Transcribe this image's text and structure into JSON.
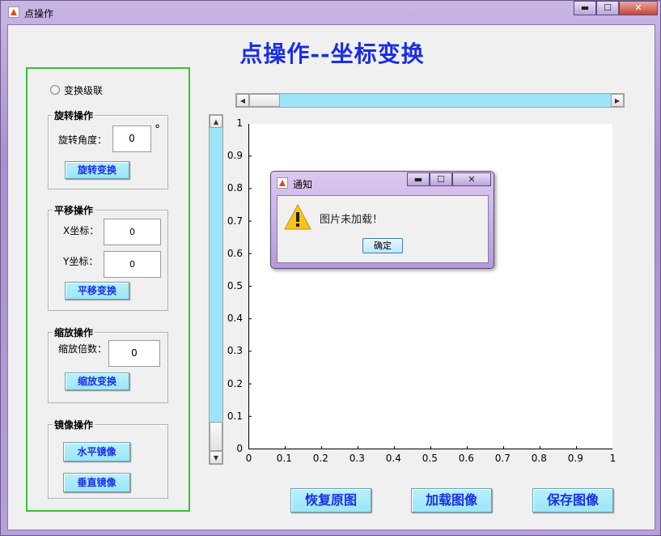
{
  "window": {
    "title": "点操作",
    "min_glyph": "▬",
    "max_glyph": "☐",
    "close_glyph": "✕"
  },
  "main_title": "点操作--坐标变换",
  "left_panel": {
    "cascade_label": "变换级联",
    "rotation": {
      "title": "旋转操作",
      "angle_label": "旋转角度：",
      "angle_value": "0",
      "degree_symbol": "°",
      "button": "旋转变换"
    },
    "translation": {
      "title": "平移操作",
      "x_label": "X坐标：",
      "x_value": "0",
      "y_label": "Y坐标：",
      "y_value": "0",
      "button": "平移变换"
    },
    "scaling": {
      "title": "缩放操作",
      "factor_label": "缩放倍数：",
      "factor_value": "0",
      "button": "缩放变换"
    },
    "mirror": {
      "title": "镜像操作",
      "horizontal_button": "水平镜像",
      "vertical_button": "垂直镜像"
    }
  },
  "axes": {
    "x_ticks": [
      "0",
      "0.1",
      "0.2",
      "0.3",
      "0.4",
      "0.5",
      "0.6",
      "0.7",
      "0.8",
      "0.9",
      "1"
    ],
    "y_ticks": [
      "0",
      "0.1",
      "0.2",
      "0.3",
      "0.4",
      "0.5",
      "0.6",
      "0.7",
      "0.8",
      "0.9",
      "1"
    ]
  },
  "scrollbars": {
    "horizontal_thumb_fraction": 0.0,
    "vertical_thumb_fraction": 0.0
  },
  "bottom_buttons": {
    "restore": "恢复原图",
    "load": "加载图像",
    "save": "保存图像"
  },
  "dialog": {
    "title": "通知",
    "message": "图片未加载！",
    "ok_button": "确定"
  },
  "colors": {
    "title_blue": "#1a2ee6",
    "panel_border_green": "#36c236",
    "button_cyan": "#9be6f8",
    "scroll_cyan": "#9fe4f6"
  }
}
